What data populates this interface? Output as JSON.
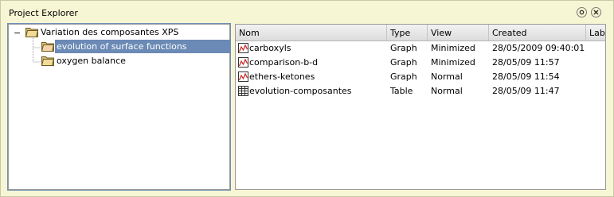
{
  "window": {
    "title": "Project Explorer",
    "buttons": {
      "float_icon": "float-icon",
      "close_icon": "close-icon"
    }
  },
  "tree": {
    "root": {
      "label": "Variation des composantes XPS",
      "expander": "−",
      "icon": "folder-icon"
    },
    "children": [
      {
        "label": "evolution of surface functions",
        "icon": "folder-icon",
        "selected": true
      },
      {
        "label": "oxygen balance",
        "icon": "folder-icon",
        "selected": false
      }
    ]
  },
  "list": {
    "columns": [
      "Nom",
      "Type",
      "View",
      "Created",
      "Lab"
    ],
    "rows": [
      {
        "name": "carboxyls",
        "type": "Graph",
        "view": "Minimized",
        "created": "28/05/2009 09:40:01",
        "icon": "graph-icon"
      },
      {
        "name": "comparison-b-d",
        "type": "Graph",
        "view": "Minimized",
        "created": "28/05/09 11:57",
        "icon": "graph-icon"
      },
      {
        "name": "ethers-ketones",
        "type": "Graph",
        "view": "Normal",
        "created": "28/05/09 11:54",
        "icon": "graph-icon"
      },
      {
        "name": "evolution-composantes",
        "type": "Table",
        "view": "Normal",
        "created": "28/05/09 11:47",
        "icon": "table-icon"
      }
    ]
  },
  "colors": {
    "background": "#f6f6d4",
    "selection": "#6b8ab5",
    "focus_border": "#6f8fb8"
  }
}
